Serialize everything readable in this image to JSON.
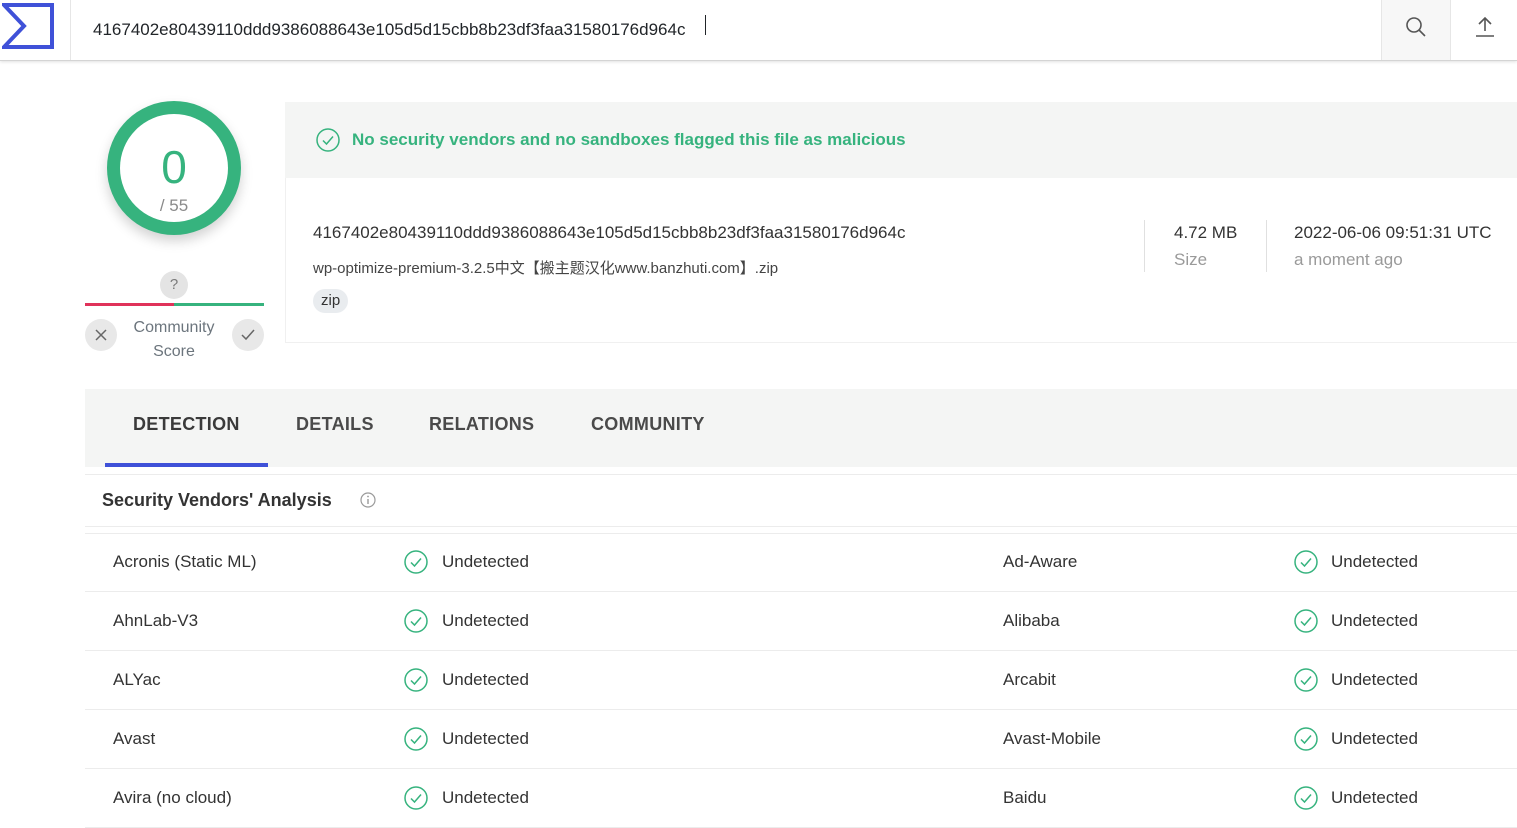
{
  "search": {
    "value": "4167402e80439110ddd9386088643e105d5d15cbb8b23df3faa31580176d964c"
  },
  "icons": {
    "logo": "virustotal-sigma-logo",
    "search": "search-icon",
    "upload": "upload-icon"
  },
  "colors": {
    "brand": "#3f51d8",
    "clean": "#36b37e",
    "malicious": "#e0325a"
  },
  "score": {
    "detections": "0",
    "total": "/ 55"
  },
  "community": {
    "question": "?",
    "label_line1": "Community",
    "label_line2": "Score"
  },
  "status": {
    "message": "No security vendors and no sandboxes flagged this file as malicious"
  },
  "file": {
    "hash": "4167402e80439110ddd9386088643e105d5d15cbb8b23df3faa31580176d964c",
    "name": "wp-optimize-premium-3.2.5中文【搬主题汉化www.banzhuti.com】.zip",
    "tag": "zip",
    "size_value": "4.72 MB",
    "size_label": "Size",
    "date_value": "2022-06-06 09:51:31 UTC",
    "date_label": "a moment ago"
  },
  "tabs": [
    "DETECTION",
    "DETAILS",
    "RELATIONS",
    "COMMUNITY"
  ],
  "analysis": {
    "title": "Security Vendors' Analysis",
    "rows": [
      {
        "left_vendor": "Acronis (Static ML)",
        "left_result": "Undetected",
        "right_vendor": "Ad-Aware",
        "right_result": "Undetected"
      },
      {
        "left_vendor": "AhnLab-V3",
        "left_result": "Undetected",
        "right_vendor": "Alibaba",
        "right_result": "Undetected"
      },
      {
        "left_vendor": "ALYac",
        "left_result": "Undetected",
        "right_vendor": "Arcabit",
        "right_result": "Undetected"
      },
      {
        "left_vendor": "Avast",
        "left_result": "Undetected",
        "right_vendor": "Avast-Mobile",
        "right_result": "Undetected"
      },
      {
        "left_vendor": "Avira (no cloud)",
        "left_result": "Undetected",
        "right_vendor": "Baidu",
        "right_result": "Undetected"
      }
    ]
  }
}
